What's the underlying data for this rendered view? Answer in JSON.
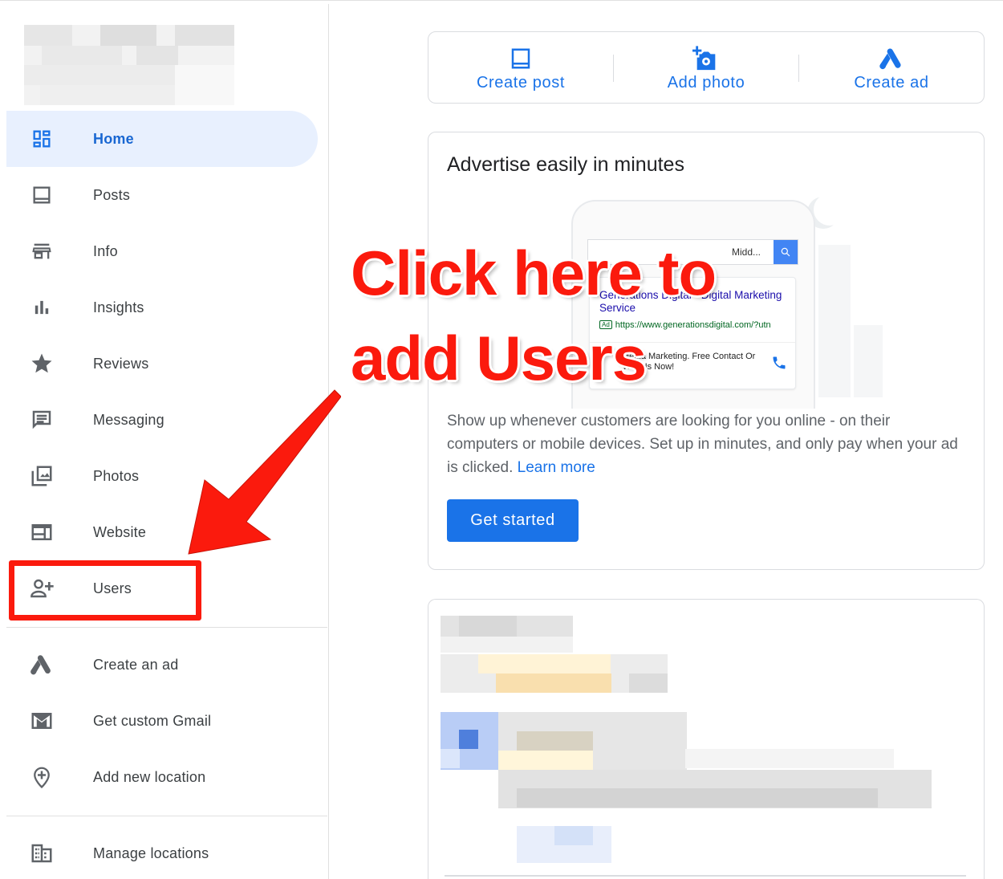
{
  "sidebar": {
    "items": [
      {
        "label": "Home",
        "icon": "dashboard-icon"
      },
      {
        "label": "Posts",
        "icon": "posts-icon"
      },
      {
        "label": "Info",
        "icon": "storefront-icon"
      },
      {
        "label": "Insights",
        "icon": "bar-chart-icon"
      },
      {
        "label": "Reviews",
        "icon": "star-icon"
      },
      {
        "label": "Messaging",
        "icon": "message-icon"
      },
      {
        "label": "Photos",
        "icon": "photos-icon"
      },
      {
        "label": "Website",
        "icon": "website-icon"
      },
      {
        "label": "Users",
        "icon": "add-person-icon"
      },
      {
        "label": "Create an ad",
        "icon": "google-ads-icon"
      },
      {
        "label": "Get custom Gmail",
        "icon": "gmail-icon"
      },
      {
        "label": "Add new location",
        "icon": "add-location-icon"
      },
      {
        "label": "Manage locations",
        "icon": "buildings-icon"
      }
    ]
  },
  "actions": [
    {
      "label": "Create post",
      "icon": "post-icon"
    },
    {
      "label": "Add photo",
      "icon": "add-photo-icon"
    },
    {
      "label": "Create ad",
      "icon": "google-ads-icon"
    }
  ],
  "ad_card": {
    "title": "Advertise easily in minutes",
    "preview": {
      "query": "Midd...",
      "result_title": "Generations Digital - Digital Marketing Service",
      "ad_tag": "Ad",
      "result_url": "https://www.generationsdigital.com/?utn",
      "result_desc": "Media Marketing. Free Contact Or Visit Us Now!"
    },
    "description": "Show up whenever customers are looking for you online - on their computers or mobile devices. Set up in minutes, and only pay when your ad is clicked.",
    "learn_more": "Learn more",
    "cta": "Get started"
  },
  "callout": {
    "line1": "Click here to",
    "line2": "add Users"
  },
  "colors": {
    "accent": "#1a73e8",
    "active_bg": "#e8f0fe",
    "annotation_red": "#fb1a0d"
  }
}
